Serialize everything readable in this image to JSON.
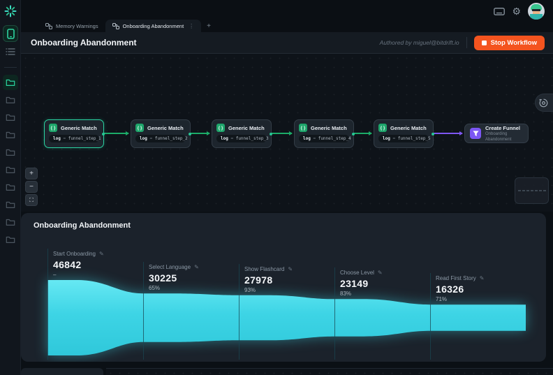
{
  "colors": {
    "accent_teal": "#2bd4a2",
    "node_green": "#1ea56b",
    "edge_green": "#1cab68",
    "edge_purple": "#7e57f2",
    "funnel_purple": "#7c57f4",
    "stop_orange": "#f4541f",
    "chart_cyan": "#3fd6e6"
  },
  "topbar": {
    "tabs": [
      {
        "label": "Memory Warnings",
        "active": false
      },
      {
        "label": "Onboarding Abandonment",
        "active": true
      }
    ],
    "kebab": "⋮",
    "new_tab": "+"
  },
  "sidebar": {
    "folder_count": 10
  },
  "header": {
    "title": "Onboarding Abandonment",
    "authored_by": "Authored by miguel@bitdrift.io",
    "stop_button": "Stop Workflow"
  },
  "workflow": {
    "nodes": [
      {
        "type": "match",
        "title": "Generic Match",
        "badge_key": "log",
        "badge_op": "=",
        "badge_value": "funnel_step_1",
        "selected": true
      },
      {
        "type": "match",
        "title": "Generic Match",
        "badge_key": "log",
        "badge_op": "=",
        "badge_value": "funnel_step_2",
        "selected": false
      },
      {
        "type": "match",
        "title": "Generic Match",
        "badge_key": "log",
        "badge_op": "=",
        "badge_value": "funnel_step_3",
        "selected": false
      },
      {
        "type": "match",
        "title": "Generic Match",
        "badge_key": "log",
        "badge_op": "=",
        "badge_value": "funnel_step_4",
        "selected": false
      },
      {
        "type": "match",
        "title": "Generic Match",
        "badge_key": "log",
        "badge_op": "=",
        "badge_value": "funnel_step_5",
        "selected": false
      },
      {
        "type": "funnel",
        "title": "Create Funnel",
        "subtitle": "Onboarding Abandonment"
      }
    ],
    "chip_glyph": "{ }"
  },
  "canvas_controls": {
    "zoom_in": "+",
    "zoom_out": "−",
    "fit": "⛶"
  },
  "funnel_panel": {
    "title": "Onboarding Abandonment"
  },
  "chart_data": {
    "type": "area",
    "title": "Onboarding Abandonment",
    "steps": [
      {
        "label": "Start Onboarding",
        "value": 46842,
        "conversion": "–"
      },
      {
        "label": "Select Language",
        "value": 30225,
        "conversion": "65%"
      },
      {
        "label": "Show Flashcard",
        "value": 27978,
        "conversion": "93%"
      },
      {
        "label": "Choose Level",
        "value": 23149,
        "conversion": "83%"
      },
      {
        "label": "Read First Story",
        "value": 16326,
        "conversion": "71%"
      }
    ],
    "max_value": 46842,
    "fill_color": "#3fd6e6",
    "pencil_glyph": "✎"
  }
}
